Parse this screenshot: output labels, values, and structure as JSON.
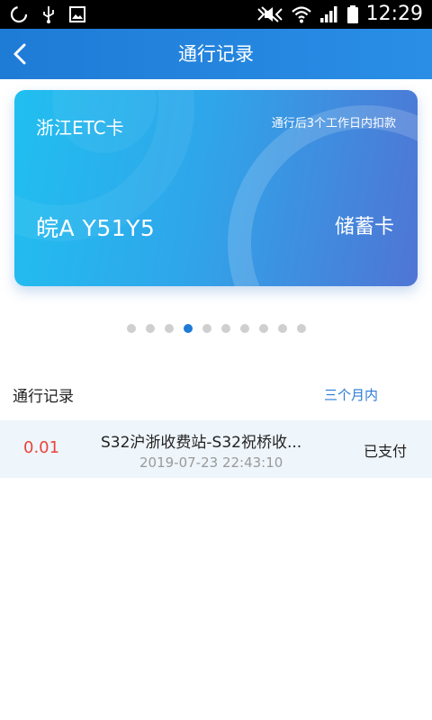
{
  "status_bar": {
    "time": "12:29",
    "icons": [
      "sync-icon",
      "usb-icon",
      "image-icon",
      "mute-icon",
      "wifi-icon",
      "signal-icon",
      "battery-icon"
    ]
  },
  "header": {
    "title": "通行记录",
    "back_icon": "chevron-left-icon"
  },
  "card": {
    "bank": "浙江ETC卡",
    "note": "通行后3个工作日内扣款",
    "plate": "皖A Y51Y5",
    "type": "储蓄卡",
    "colors": {
      "start": "#21bff0",
      "end": "#4f75d4"
    }
  },
  "pager": {
    "total": 10,
    "active_index": 3
  },
  "records": {
    "title": "通行记录",
    "filter": "三个月内",
    "items": [
      {
        "amount": "0.01",
        "route": "S32沪浙收费站-S32祝桥收...",
        "time": "2019-07-23 22:43:10",
        "status": "已支付"
      }
    ]
  },
  "colors": {
    "accent": "#1e7bd6",
    "amount": "#e8443a",
    "row_bg": "#eef5fb"
  }
}
